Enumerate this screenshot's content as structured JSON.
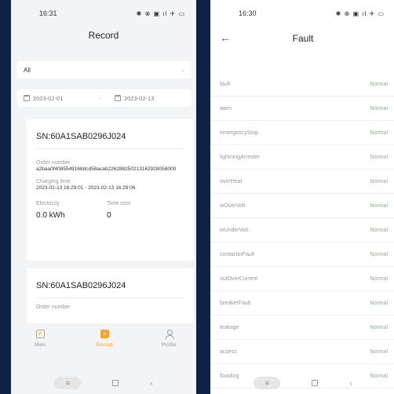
{
  "left": {
    "status_time": "16:31",
    "status_icons": "✱ ⊗ ▣ ıl ✈ ▭",
    "title": "Record",
    "filter_value": "All",
    "date_start": "2023-02-01",
    "date_sep": "-",
    "date_end": "2023-02-13",
    "records": [
      {
        "sn": "SN:60A1SAB0296J024",
        "order_label": "Order number",
        "order_value": "a2baa0f4085549168dcd58acab226288250213162928058000",
        "charging_label": "Charging time",
        "charging_value": "2023-02-13 16:29:01 - 2023-02-13 16:29:06",
        "electricity_label": "Electricity",
        "electricity_value": "0.0 kWh",
        "time_label": "Time cost",
        "time_value": "0"
      },
      {
        "sn": "SN:60A1SAB0296J024",
        "order_label": "Order number"
      }
    ],
    "nav": [
      {
        "label": "Main",
        "icon": "main-icon"
      },
      {
        "label": "Record",
        "icon": "record-icon"
      },
      {
        "label": "Profile",
        "icon": "profile-icon"
      }
    ]
  },
  "right": {
    "status_time": "16:30",
    "status_icons": "✱ ⊗ ▣ ıl ✈ ▭",
    "title": "Fault",
    "faults": [
      {
        "name": "fault",
        "status": "Normal"
      },
      {
        "name": "warn",
        "status": "Normal"
      },
      {
        "name": "emergencyStop",
        "status": "Normal"
      },
      {
        "name": "lightningArrester",
        "status": "Normal"
      },
      {
        "name": "overHeat",
        "status": "Normal"
      },
      {
        "name": "inOverVolt",
        "status": "Normal"
      },
      {
        "name": "inUnderVolt",
        "status": "Normal"
      },
      {
        "name": "contactorFault",
        "status": "Normal"
      },
      {
        "name": "outOverCurrent",
        "status": "Normal"
      },
      {
        "name": "breakerFault",
        "status": "Normal"
      },
      {
        "name": "leakage",
        "status": "Normal"
      },
      {
        "name": "access",
        "status": "Normal"
      },
      {
        "name": "flooding",
        "status": "Normal"
      }
    ]
  },
  "colors": {
    "background": "#0f2246",
    "accent": "#f2a638",
    "normal_status": "#6cc27b"
  }
}
